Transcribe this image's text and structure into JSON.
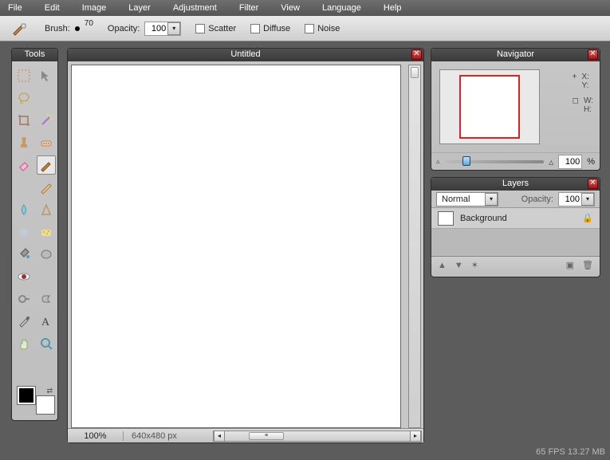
{
  "menu": [
    "File",
    "Edit",
    "Image",
    "Layer",
    "Adjustment",
    "Filter",
    "View",
    "Language",
    "Help"
  ],
  "optionbar": {
    "brush_label": "Brush:",
    "brush_size": "70",
    "opacity_label": "Opacity:",
    "opacity_value": "100",
    "scatter": "Scatter",
    "diffuse": "Diffuse",
    "noise": "Noise"
  },
  "panels": {
    "tools_title": "Tools",
    "doc_title": "Untitled",
    "navigator_title": "Navigator",
    "layers_title": "Layers"
  },
  "doc": {
    "zoom": "100%",
    "dims": "640x480 px"
  },
  "navigator": {
    "x_label": "X:",
    "y_label": "Y:",
    "w_label": "W:",
    "h_label": "H:",
    "zoom_value": "100",
    "zoom_pct": "%"
  },
  "layers": {
    "blendmode": "Normal",
    "opacity_label": "Opacity:",
    "opacity_value": "100",
    "items": [
      {
        "name": "Background"
      }
    ]
  },
  "status": "65 FPS 13.27 MB"
}
